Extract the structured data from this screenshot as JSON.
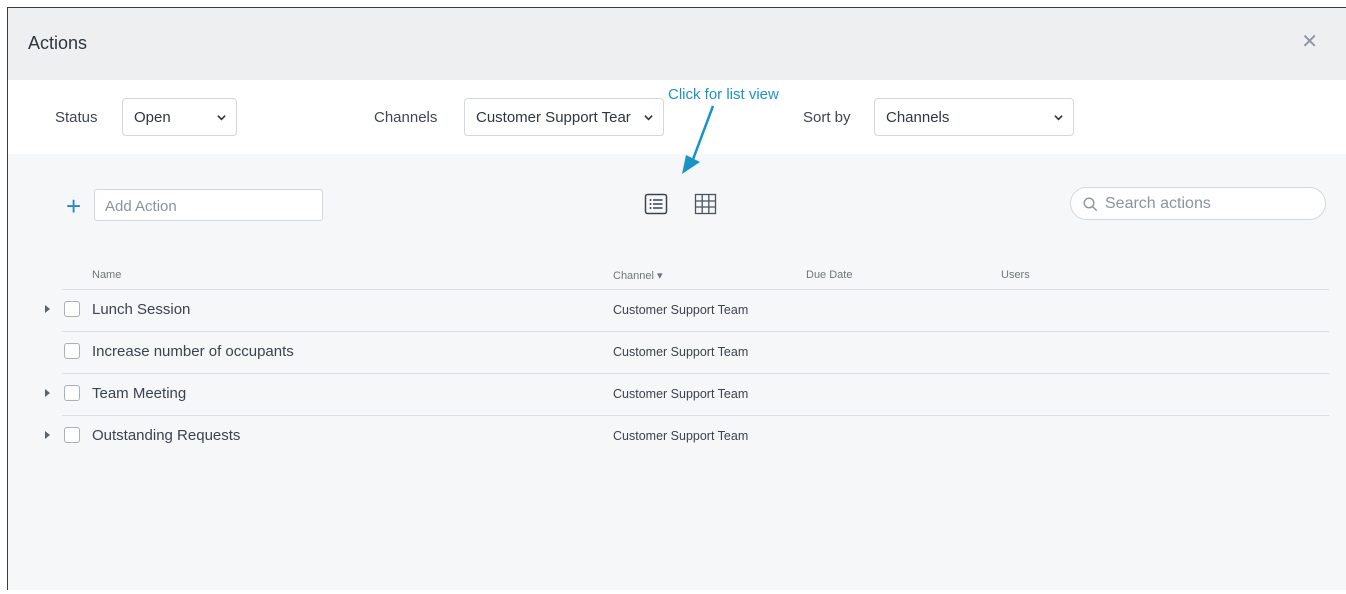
{
  "header": {
    "title": "Actions",
    "close_icon": "close-icon"
  },
  "filters": {
    "status_label": "Status",
    "status_value": "Open",
    "channels_label": "Channels",
    "channels_value": "Customer Support Tear",
    "sortby_label": "Sort by",
    "sortby_value": "Channels"
  },
  "annotation": {
    "text": "Click for list view",
    "color": "#1a94c4"
  },
  "toolbar": {
    "add_icon": "plus-icon",
    "add_placeholder": "Add Action",
    "list_view_icon": "list-view-icon",
    "grid_view_icon": "grid-view-icon",
    "search_placeholder": "Search actions"
  },
  "table": {
    "columns": [
      "Name",
      "Channel ▾",
      "Due Date",
      "Users"
    ],
    "rows": [
      {
        "name": "Lunch Session",
        "channel": "Customer Support Team",
        "expandable": true
      },
      {
        "name": "Increase number of occupants",
        "channel": "Customer Support Team",
        "expandable": false
      },
      {
        "name": "Team Meeting",
        "channel": "Customer Support Team",
        "expandable": true
      },
      {
        "name": "Outstanding Requests",
        "channel": "Customer Support Team",
        "expandable": true
      }
    ]
  },
  "colors": {
    "accent": "#2a86c8",
    "header_bg": "#edeff1",
    "body_bg": "#f6f7f8"
  }
}
